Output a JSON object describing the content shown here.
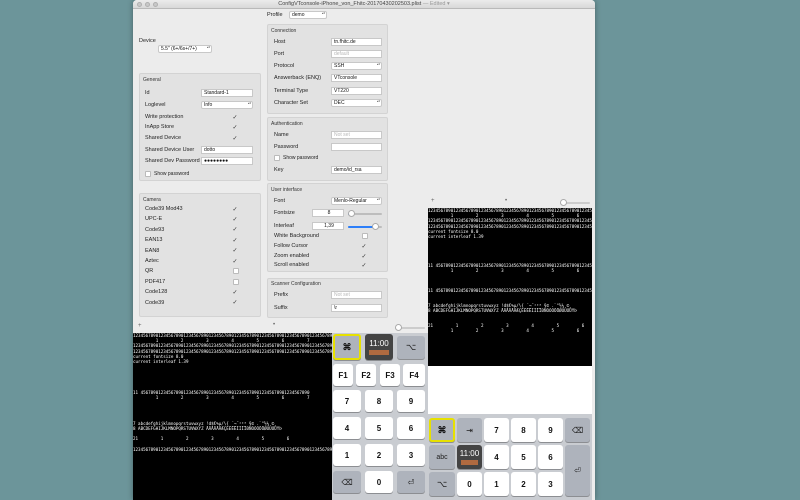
{
  "window": {
    "title": "ConfigVTconsole-iPhone_von_Fhitc-20170430202503.plist",
    "edited": "— Edited ▾"
  },
  "profile": {
    "label": "Profile",
    "value": "demo"
  },
  "device": {
    "label": "Device",
    "value": "5.5\" (6+/6s+/7+)"
  },
  "general": {
    "title": "General",
    "id_label": "Id",
    "id_value": "Standard-1",
    "loglevel_label": "Loglevel",
    "loglevel_value": "Info",
    "write_protection": "Write protection",
    "inapp_store": "InApp Store",
    "shared_device": "Shared Device",
    "shared_user_label": "Shared Device User",
    "shared_user_value": "dotto",
    "shared_pass_label": "Shared Dev Password",
    "shared_pass_value": "●●●●●●●●",
    "show_password": "Show password"
  },
  "camera": {
    "title": "Camera",
    "items": [
      {
        "label": "Code39 Mod43",
        "checked": true
      },
      {
        "label": "UPC-E",
        "checked": true
      },
      {
        "label": "Code93",
        "checked": true
      },
      {
        "label": "EAN13",
        "checked": true
      },
      {
        "label": "EAN8",
        "checked": true
      },
      {
        "label": "Aztec",
        "checked": true
      },
      {
        "label": "QR",
        "checked": false
      },
      {
        "label": "PDF417",
        "checked": false
      },
      {
        "label": "Code128",
        "checked": true
      },
      {
        "label": "Code39",
        "checked": true
      }
    ]
  },
  "connection": {
    "title": "Connection",
    "host_label": "Host",
    "host_value": "tn.fhitc.de",
    "port_label": "Port",
    "port_placeholder": "default",
    "protocol_label": "Protocol",
    "protocol_value": "SSH",
    "answerback_label": "Answerback (ENQ)",
    "answerback_value": "VTconsole",
    "terminal_label": "Terminal Type",
    "terminal_value": "VT220",
    "charset_label": "Character Set",
    "charset_value": "DEC"
  },
  "authentication": {
    "title": "Authentication",
    "name_label": "Name",
    "name_placeholder": "Not set",
    "password_label": "Password",
    "show_password": "Show password",
    "key_label": "Key",
    "key_value": "demo/id_rsa"
  },
  "user_interface": {
    "title": "User interface",
    "font_label": "Font",
    "font_value": "Menlo-Regular",
    "fontsize_label": "Fontsize",
    "fontsize_value": "8",
    "fontsize_level": 0.1,
    "interleaf_label": "Interleaf",
    "interleaf_value": "1,39",
    "interleaf_level": 0.8,
    "white_bg": "White Background",
    "follow_cursor": "Follow Cursor",
    "zoom_enabled": "Zoom enabled",
    "scroll_enabled": "Scroll enabled"
  },
  "scanner": {
    "title": "Scanner Configuration",
    "prefix_label": "Prefix",
    "prefix_placeholder": "Not set",
    "suffix_label": "Suffix",
    "suffix_value": "\\r"
  },
  "terminal_text": {
    "ruler": "12345678901234567890123456789012345678901234567890123456789012345678901234567890",
    "cols": "         1         2         3         4         5         6         7         8",
    "fontsize": "current fontsize 8.0",
    "interleaf": "current interleaf 1.39",
    "ruler2": "11 4567890123456789012345678901234567890123456789012345678901234567890",
    "lower": "7 abcdefghijklmnopqrstuvwxyz !d$€%µ/\\{ ´¬¨¹²³ §© .`°½¼¸©¸",
    "upper": "8 ABCDEFGHIJKLMNOPQRSTUVWXYZ ÄÄÄÄÄÄÆÇÈÉÊËÌÍÎÏÐÑÒÓÔÕÖØÙÚÛÜÝÞ",
    "cols21": "21         1         2         3         4         5         6"
  },
  "keypad": {
    "cmd": "⌘",
    "clock": "11:00",
    "opt": "⌥",
    "f1": "F1",
    "f2": "F2",
    "f3": "F3",
    "f4": "F4",
    "k7": "7",
    "k8": "8",
    "k9": "9",
    "k4": "4",
    "k5": "5",
    "k6": "6",
    "k1": "1",
    "k2": "2",
    "k3": "3",
    "k0": "0",
    "del": "⌫",
    "tab": "⇥",
    "abc": "abc",
    "enter": "⏎"
  },
  "colors": {
    "desktop": "#6c959a",
    "highlight": "#e7e100",
    "slider": "#2d7ff9"
  }
}
